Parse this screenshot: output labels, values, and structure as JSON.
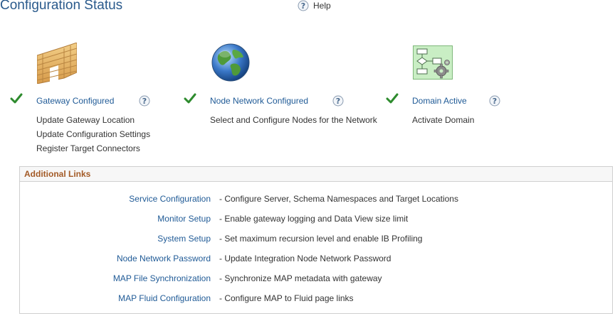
{
  "page": {
    "title": "Configuration Status",
    "help_label": "Help"
  },
  "steps": [
    {
      "status_label": "Gateway Configured",
      "icon": "brick-wall-icon",
      "links": [
        "Update Gateway Location",
        "Update Configuration Settings",
        "Register Target Connectors"
      ]
    },
    {
      "status_label": "Node Network Configured",
      "icon": "globe-icon",
      "links": [
        "Select and Configure Nodes for the Network"
      ]
    },
    {
      "status_label": "Domain Active",
      "icon": "flowchart-gear-icon",
      "links": [
        "Activate Domain"
      ]
    }
  ],
  "additional_links": {
    "title": "Additional Links",
    "items": [
      {
        "name": "Service Configuration",
        "desc": "- Configure Server, Schema Namespaces and Target Locations"
      },
      {
        "name": "Monitor Setup",
        "desc": "- Enable gateway logging and Data View size limit"
      },
      {
        "name": "System Setup",
        "desc": "- Set maximum recursion level and enable IB Profiling"
      },
      {
        "name": "Node Network Password",
        "desc": "- Update Integration Node Network Password"
      },
      {
        "name": "MAP File Synchronization",
        "desc": "- Synchronize MAP metadata with gateway"
      },
      {
        "name": "MAP Fluid Configuration",
        "desc": "- Configure MAP to Fluid page links"
      }
    ]
  },
  "colors": {
    "link": "#1f5a96",
    "title": "#2a5a8c",
    "section_header": "#a35a26",
    "check": "#2e8b2e"
  }
}
